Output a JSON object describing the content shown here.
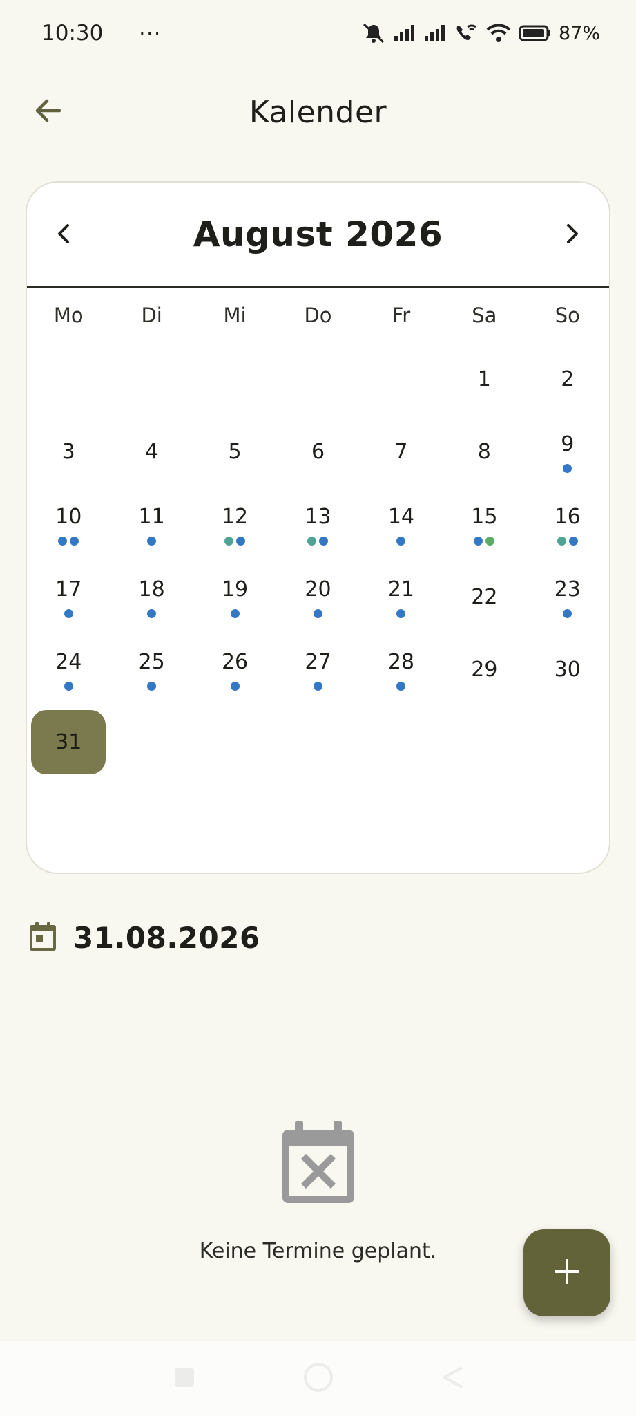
{
  "status_bar": {
    "time": "10:30",
    "more": "···",
    "battery": "87%"
  },
  "app_bar": {
    "title": "Kalender"
  },
  "calendar": {
    "month_label": "August 2026",
    "weekdays": [
      "Mo",
      "Di",
      "Mi",
      "Do",
      "Fr",
      "Sa",
      "So"
    ],
    "leading_blank_days": 5,
    "selected_day": 31,
    "colors": {
      "event_blue": "#3378c4",
      "event_teal": "#4ea394",
      "event_green": "#5aac63",
      "selected_bg": "#7a7a4e"
    },
    "days": [
      {
        "day": "1",
        "dots": []
      },
      {
        "day": "2",
        "dots": []
      },
      {
        "day": "3",
        "dots": []
      },
      {
        "day": "4",
        "dots": []
      },
      {
        "day": "5",
        "dots": []
      },
      {
        "day": "6",
        "dots": []
      },
      {
        "day": "7",
        "dots": []
      },
      {
        "day": "8",
        "dots": []
      },
      {
        "day": "9",
        "dots": [
          "event_blue"
        ]
      },
      {
        "day": "10",
        "dots": [
          "event_blue",
          "event_blue"
        ]
      },
      {
        "day": "11",
        "dots": [
          "event_blue"
        ]
      },
      {
        "day": "12",
        "dots": [
          "event_teal",
          "event_blue"
        ]
      },
      {
        "day": "13",
        "dots": [
          "event_teal",
          "event_blue"
        ]
      },
      {
        "day": "14",
        "dots": [
          "event_blue"
        ]
      },
      {
        "day": "15",
        "dots": [
          "event_blue",
          "event_green"
        ]
      },
      {
        "day": "16",
        "dots": [
          "event_teal",
          "event_blue"
        ]
      },
      {
        "day": "17",
        "dots": [
          "event_blue"
        ]
      },
      {
        "day": "18",
        "dots": [
          "event_blue"
        ]
      },
      {
        "day": "19",
        "dots": [
          "event_blue"
        ]
      },
      {
        "day": "20",
        "dots": [
          "event_blue"
        ]
      },
      {
        "day": "21",
        "dots": [
          "event_blue"
        ]
      },
      {
        "day": "22",
        "dots": []
      },
      {
        "day": "23",
        "dots": [
          "event_blue"
        ]
      },
      {
        "day": "24",
        "dots": [
          "event_blue"
        ]
      },
      {
        "day": "25",
        "dots": [
          "event_blue"
        ]
      },
      {
        "day": "26",
        "dots": [
          "event_blue"
        ]
      },
      {
        "day": "27",
        "dots": [
          "event_blue"
        ]
      },
      {
        "day": "28",
        "dots": [
          "event_blue"
        ]
      },
      {
        "day": "29",
        "dots": []
      },
      {
        "day": "30",
        "dots": []
      },
      {
        "day": "31",
        "dots": []
      }
    ]
  },
  "selected_date": {
    "icon": "calendar-today-icon",
    "text": "31.08.2026"
  },
  "empty_state": {
    "icon": "calendar-remove-icon",
    "text": "Keine Termine geplant."
  },
  "fab": {
    "icon": "plus-icon",
    "color": "#626338"
  }
}
